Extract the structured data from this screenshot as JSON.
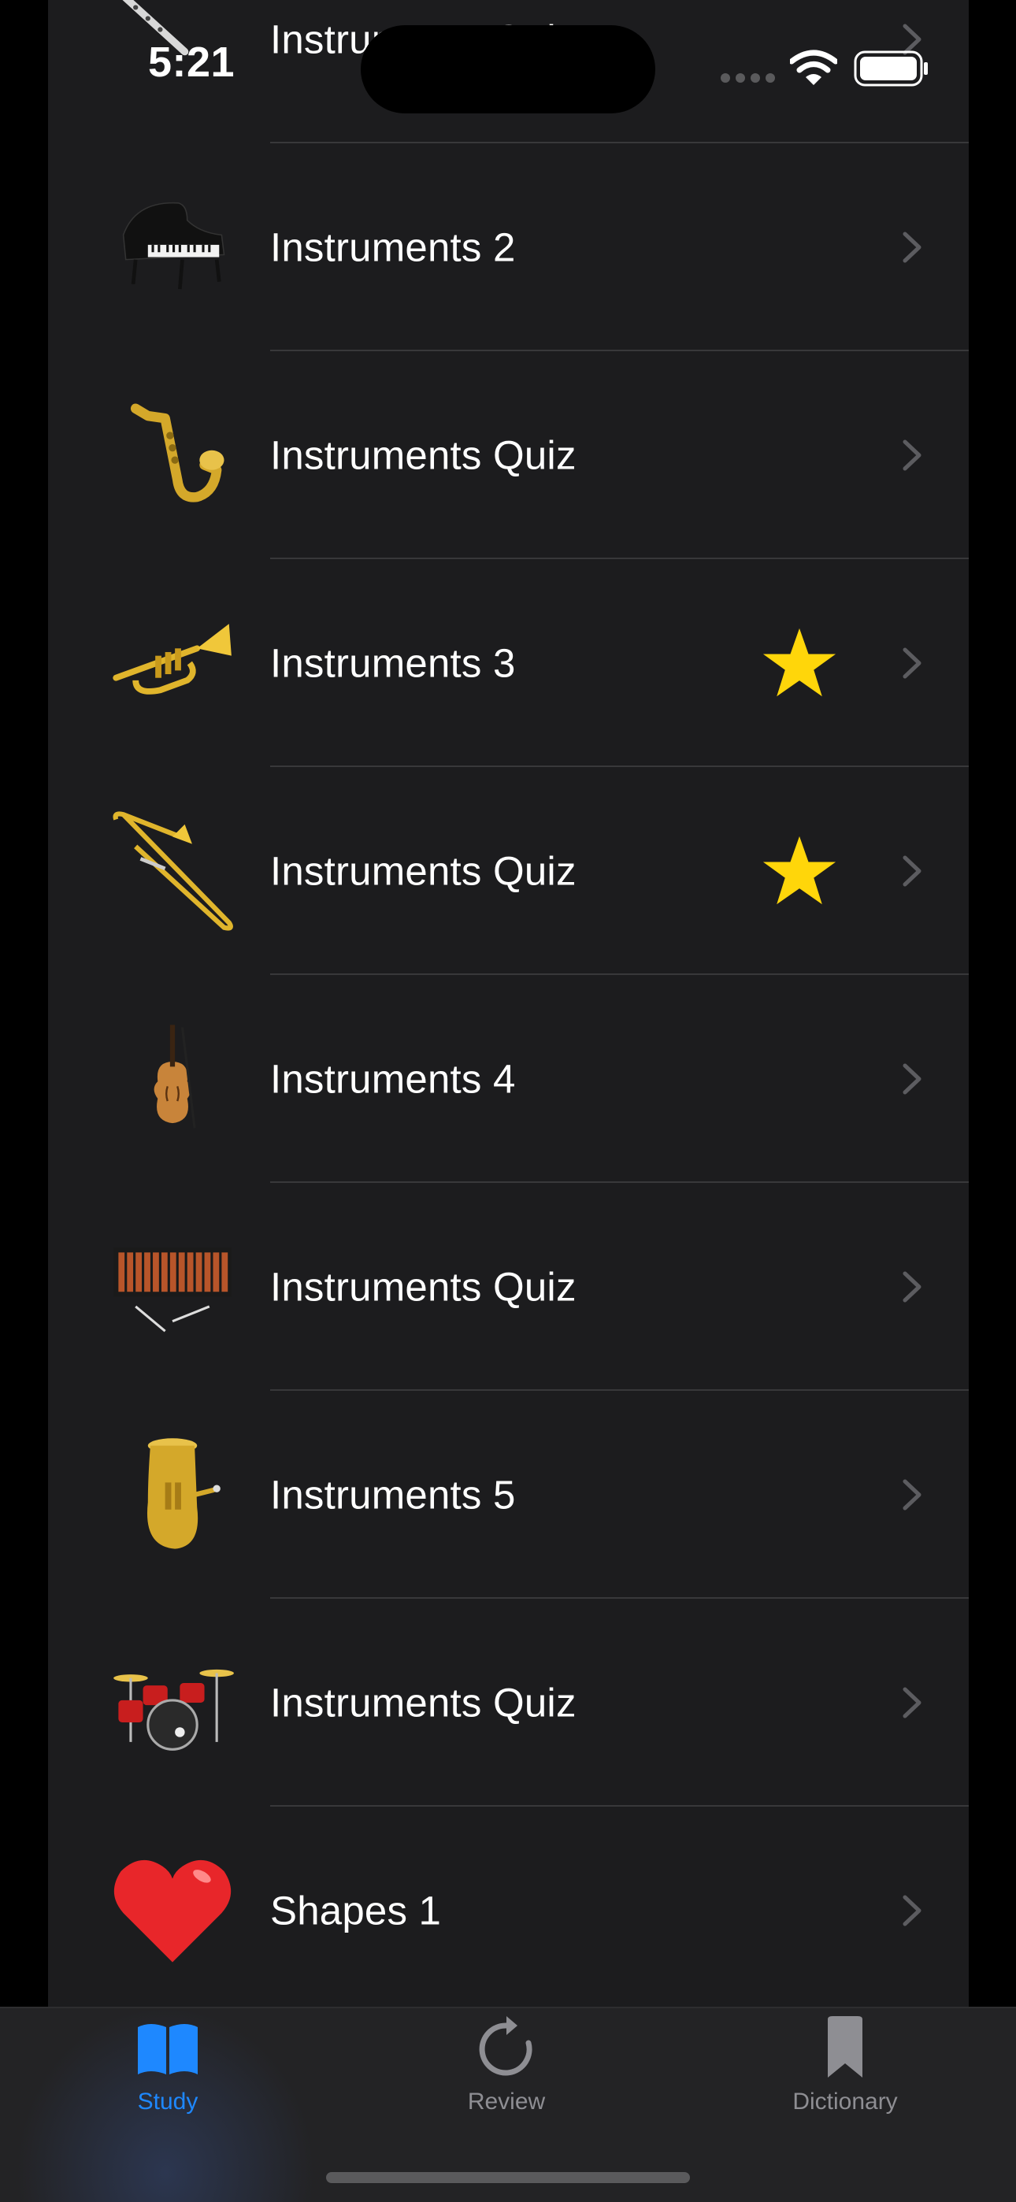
{
  "status_bar": {
    "time": "5:21"
  },
  "list": {
    "rows": [
      {
        "label": "Instruments Quiz",
        "icon": "flute-icon",
        "starred": false
      },
      {
        "label": "Instruments 2",
        "icon": "grand-piano-icon",
        "starred": false
      },
      {
        "label": "Instruments Quiz",
        "icon": "saxophone-icon",
        "starred": false
      },
      {
        "label": "Instruments 3",
        "icon": "trumpet-icon",
        "starred": true
      },
      {
        "label": "Instruments Quiz",
        "icon": "trombone-icon",
        "starred": true
      },
      {
        "label": "Instruments 4",
        "icon": "violin-icon",
        "starred": false
      },
      {
        "label": "Instruments Quiz",
        "icon": "xylophone-icon",
        "starred": false
      },
      {
        "label": "Instruments 5",
        "icon": "tuba-icon",
        "starred": false
      },
      {
        "label": "Instruments Quiz",
        "icon": "drum-kit-icon",
        "starred": false
      },
      {
        "label": "Shapes 1",
        "icon": "heart-icon",
        "starred": false
      }
    ]
  },
  "tab_bar": {
    "active": "study",
    "tabs": [
      {
        "label": "Study",
        "icon": "open-book-icon"
      },
      {
        "label": "Review",
        "icon": "refresh-icon"
      },
      {
        "label": "Dictionary",
        "icon": "bookmark-icon"
      }
    ]
  },
  "colors": {
    "accent": "#1e88ff",
    "star": "#ffd60a",
    "row_background": "#1c1c1e",
    "separator": "#38383a"
  }
}
